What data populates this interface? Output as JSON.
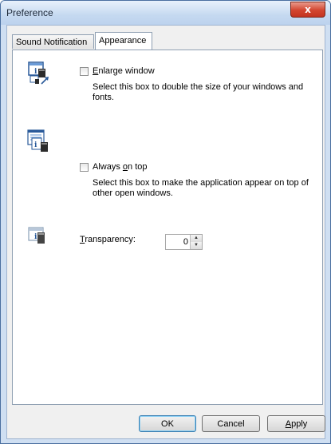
{
  "window": {
    "title": "Preference",
    "close_glyph": "x"
  },
  "tabs": [
    {
      "label": "Sound Notification",
      "selected": false
    },
    {
      "label": "Appearance",
      "selected": true
    }
  ],
  "options": {
    "enlarge": {
      "label_accel": "E",
      "label_rest": "nlarge window",
      "checked": false,
      "description_line1": "Select this box to double the size of your windows and",
      "description_line2": "fonts.",
      "icon": "enlarge-window-icon"
    },
    "ontop": {
      "label_pre": "Always ",
      "label_accel": "o",
      "label_rest": "n top",
      "checked": false,
      "description_line1": "Select this box to make the application appear on top of",
      "description_line2": "other open windows.",
      "icon": "always-on-top-icon"
    },
    "transparency": {
      "label_accel": "T",
      "label_rest": "ransparency:",
      "value": "0",
      "icon": "transparency-icon"
    }
  },
  "buttons": {
    "ok": "OK",
    "cancel": "Cancel",
    "apply_accel": "A",
    "apply_rest": "pply"
  }
}
